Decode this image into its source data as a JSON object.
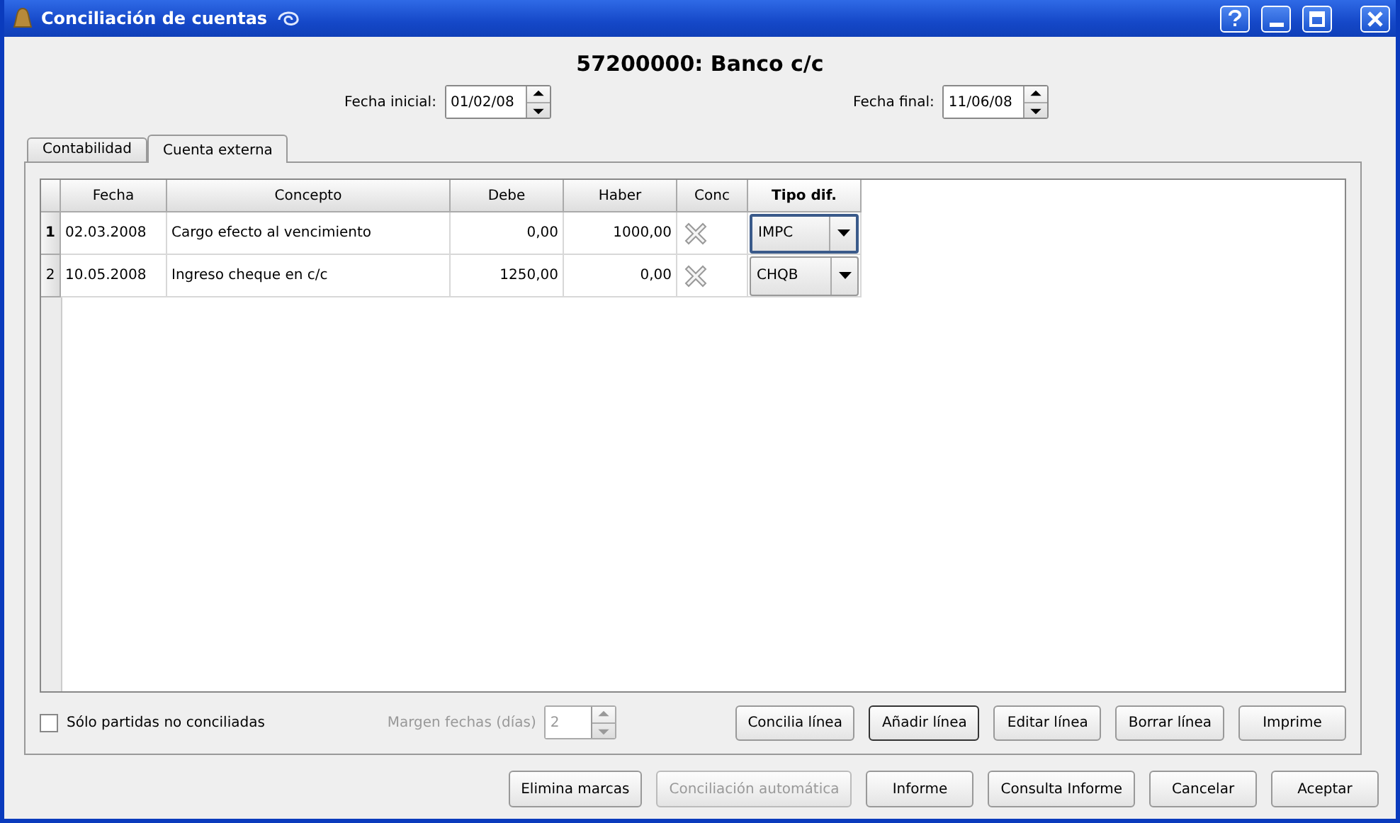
{
  "window": {
    "title": "Conciliación de cuentas"
  },
  "heading": "57200000: Banco c/c",
  "dates": [
    {
      "label": "Fecha inicial:",
      "value": "01/02/08"
    },
    {
      "label": "Fecha final:",
      "value": "11/06/08"
    }
  ],
  "tabs": [
    {
      "label": "Contabilidad",
      "selected": false
    },
    {
      "label": "Cuenta externa",
      "selected": true
    }
  ],
  "table": {
    "columns": [
      {
        "label": "Fecha",
        "selected": false
      },
      {
        "label": "Concepto",
        "selected": false
      },
      {
        "label": "Debe",
        "selected": false
      },
      {
        "label": "Haber",
        "selected": false
      },
      {
        "label": "Conc",
        "selected": false
      },
      {
        "label": "Tipo dif.",
        "selected": true
      }
    ],
    "rows": [
      {
        "number": "1",
        "selected": true,
        "fecha": "02.03.2008",
        "concepto": "Cargo efecto al vencimiento",
        "debe": "0,00",
        "haber": "1000,00",
        "tipo": "IMPC",
        "tipo_focused": true
      },
      {
        "number": "2",
        "selected": false,
        "fecha": "10.05.2008",
        "concepto": "Ingreso cheque en c/c",
        "debe": "1250,00",
        "haber": "0,00",
        "tipo": "CHQB",
        "tipo_focused": false
      }
    ]
  },
  "only_unreconciled": {
    "label": "Sólo partidas no conciliadas",
    "checked": false
  },
  "margin": {
    "label": "Margen fechas (días)",
    "value": "2",
    "disabled": true
  },
  "panel_buttons": [
    {
      "label": "Concilia línea",
      "default": false
    },
    {
      "label": "Añadir línea",
      "default": true
    },
    {
      "label": "Editar línea",
      "default": false
    },
    {
      "label": "Borrar línea",
      "default": false
    },
    {
      "label": "Imprime",
      "default": false
    }
  ],
  "dialog_buttons": [
    {
      "label": "Elimina marcas",
      "disabled": false
    },
    {
      "label": "Conciliación automática",
      "disabled": true
    },
    {
      "label": "Informe",
      "disabled": false
    },
    {
      "label": "Consulta Informe",
      "disabled": false
    },
    {
      "label": "Cancelar",
      "disabled": false
    },
    {
      "label": "Aceptar",
      "disabled": false
    }
  ]
}
